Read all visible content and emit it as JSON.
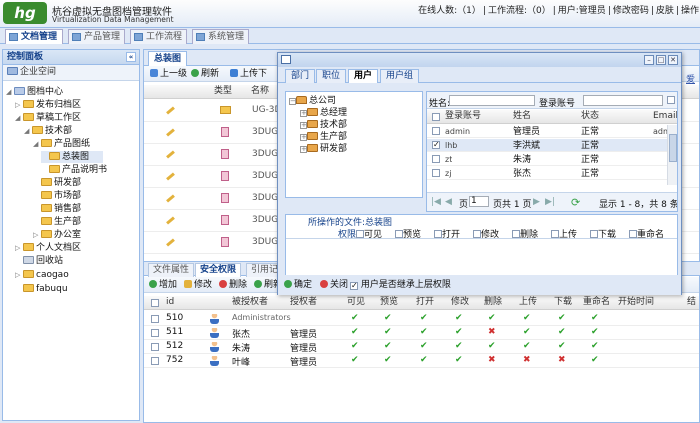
{
  "app": {
    "logo": "hg",
    "title": "杭谷虚拟无盘图档管理软件",
    "subtitle": "Virtualization Data Management"
  },
  "userinfo": {
    "online": "在线人数:（1）",
    "workflow": "工作流程:（0）",
    "user": "用户:管理员",
    "change_pwd": "修改密码",
    "skin": "皮肤",
    "action": "操作",
    "sep": "|"
  },
  "main_tabs": [
    "文档管理",
    "产品管理",
    "工作流程",
    "系统管理"
  ],
  "left": {
    "title": "控制面板",
    "collapse": "«",
    "enterprise": "企业空间",
    "tree": [
      "图档中心",
      "发布归档区",
      "草稿工作区",
      "技术部",
      "产品图纸",
      "总装图",
      "产品说明书",
      "研发部",
      "市场部",
      "销售部",
      "生产部",
      "办公室",
      "个人文档区",
      "回收站",
      "caogao",
      "fabuqu"
    ]
  },
  "doc_tab": "总装图",
  "toolbar": [
    "上一级",
    "刷新",
    "上传",
    "下"
  ],
  "doc_grid": {
    "headers": [
      "类型",
      "名称"
    ],
    "names": [
      "UG-3D",
      "3DUGP",
      "3DUGP",
      "3DUGP",
      "3DUGP",
      "3DUGP",
      "3DUGP"
    ]
  },
  "doc_right_link": "爱",
  "bottom_tabs": [
    "文件属性",
    "安全权限",
    "引用记"
  ],
  "perm_toolbar": [
    "增加",
    "修改",
    "删除",
    "刷新"
  ],
  "perm_grid": {
    "headers": [
      "id",
      "被授权者",
      "授权者",
      "可见",
      "预览",
      "打开",
      "修改",
      "删除",
      "上传",
      "下载",
      "重命名",
      "开始时间",
      "结"
    ],
    "rows": [
      {
        "id": "510",
        "grantee": "Administrators",
        "grantor": "",
        "perms": [
          "✔",
          "✔",
          "✔",
          "✔",
          "✔",
          "✔",
          "✔",
          "✔"
        ]
      },
      {
        "id": "511",
        "grantee": "张杰",
        "grantor": "管理员",
        "perms": [
          "✔",
          "✔",
          "✔",
          "✔",
          "✖",
          "✔",
          "✔",
          "✔"
        ]
      },
      {
        "id": "512",
        "grantee": "朱涛",
        "grantor": "管理员",
        "perms": [
          "✔",
          "✔",
          "✔",
          "✔",
          "✔",
          "✔",
          "✔",
          "✔"
        ]
      },
      {
        "id": "752",
        "grantee": "叶峰",
        "grantor": "管理员",
        "perms": [
          "✔",
          "✔",
          "✔",
          "✔",
          "✖",
          "✖",
          "✖",
          "✔"
        ]
      }
    ]
  },
  "dialog": {
    "tabs": [
      "部门",
      "职位",
      "用户",
      "用户组"
    ],
    "tree": [
      "总公司",
      "总经理",
      "技术部",
      "生产部",
      "研发部"
    ],
    "search": {
      "name_label": "姓名:",
      "account_label": "登录账号"
    },
    "headers": [
      "登录账号",
      "姓名",
      "状态",
      "Email"
    ],
    "rows": [
      {
        "account": "admin",
        "name": "管理员",
        "status": "正常",
        "email": "adm",
        "checked": false
      },
      {
        "account": "lhb",
        "name": "李洪斌",
        "status": "正常",
        "email": "",
        "checked": true
      },
      {
        "account": "zt",
        "name": "朱涛",
        "status": "正常",
        "email": "",
        "checked": false
      },
      {
        "account": "zj",
        "name": "张杰",
        "status": "正常",
        "email": "",
        "checked": false
      }
    ],
    "pager": {
      "page_label": "页",
      "page_value": "1",
      "total": "页共 1 页",
      "display": "显示 1 - 8，共 8 条"
    },
    "file_label": "所操作的文件:总装图",
    "perm_label": "权限",
    "perms": [
      "可见",
      "预览",
      "打开",
      "修改",
      "删除",
      "上传",
      "下载",
      "重命名"
    ],
    "ok": "确定",
    "close": "关闭",
    "inherit": "用户是否继承上层权限"
  }
}
